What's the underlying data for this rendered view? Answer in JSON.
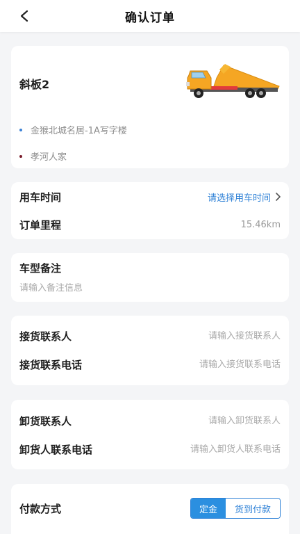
{
  "header": {
    "title": "确认订单"
  },
  "vehicle": {
    "name": "斜板2",
    "pickup_address": "金猴北城名居-1A写字楼",
    "dropoff_address": "孝河人家",
    "pickup_dot_color": "#3b82d6",
    "dropoff_dot_color": "#7a1c2c"
  },
  "trip": {
    "time_label": "用车时间",
    "time_value": "请选择用车时间",
    "distance_label": "订单里程",
    "distance_value": "15.46km"
  },
  "remark": {
    "label": "车型备注",
    "placeholder": "请输入备注信息"
  },
  "pickup_contact": {
    "name_label": "接货联系人",
    "name_placeholder": "请输入接货联系人",
    "phone_label": "接货联系电话",
    "phone_placeholder": "请输入接货联系电话"
  },
  "dropoff_contact": {
    "name_label": "卸货联系人",
    "name_placeholder": "请输入卸货联系人",
    "phone_label": "卸货人联系电话",
    "phone_placeholder": "请输入卸货人联系电话"
  },
  "payment": {
    "label": "付款方式",
    "options": [
      "定金",
      "货到付款"
    ],
    "selected": "定金"
  },
  "colors": {
    "accent": "#2b7fd6",
    "background": "#f4f5f7"
  }
}
